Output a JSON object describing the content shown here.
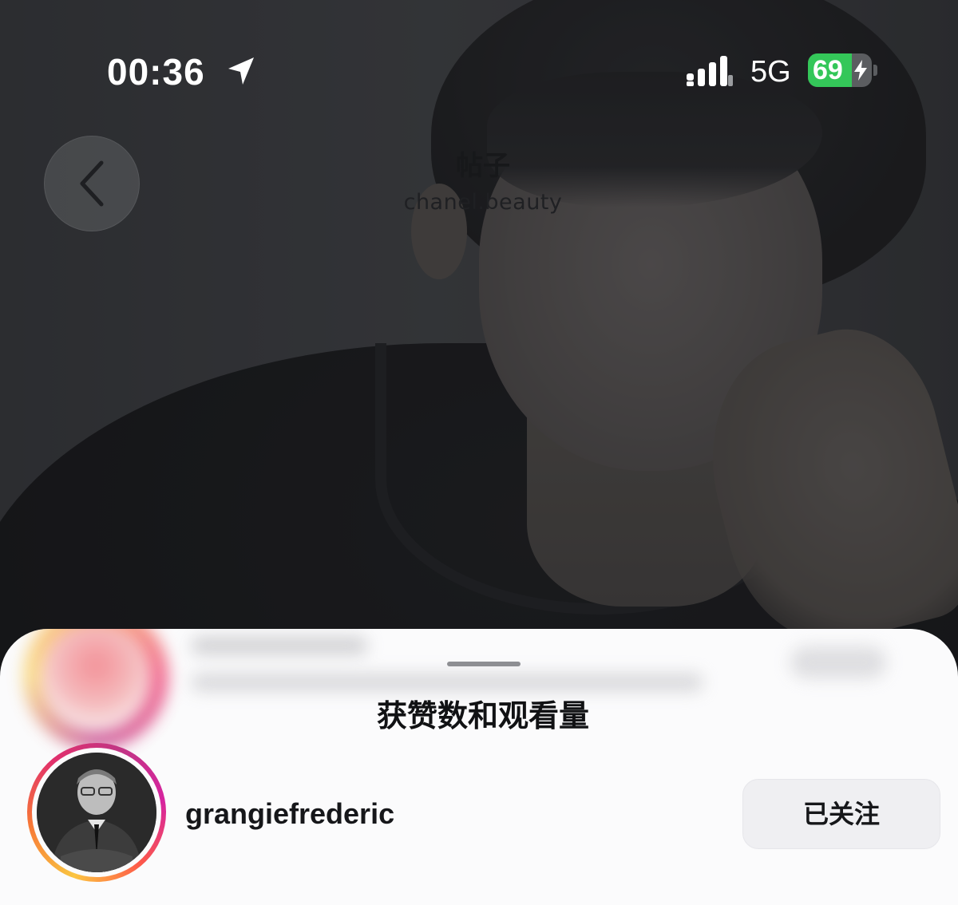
{
  "status_bar": {
    "time": "00:36",
    "location_icon": "location-arrow-icon",
    "signal_icon": "cellular-signal-icon",
    "network": "5G",
    "battery_percent": "69",
    "battery_level": 0.69,
    "battery_charging_icon": "bolt-icon",
    "battery_color": "#34c759"
  },
  "header": {
    "back_icon": "chevron-left-icon",
    "title": "帖子",
    "subtitle": "chanel.beauty"
  },
  "sheet": {
    "title": "获赞数和观看量",
    "user": {
      "username": "grangiefrederic",
      "avatar": "avatar-photo",
      "follow_label": "已关注"
    }
  },
  "colors": {
    "sheet_background": "#fbfbfc",
    "follow_button_background": "#efeff2",
    "story_ring": [
      "#f9c440",
      "#f77737",
      "#e1306c",
      "#c13584"
    ]
  }
}
